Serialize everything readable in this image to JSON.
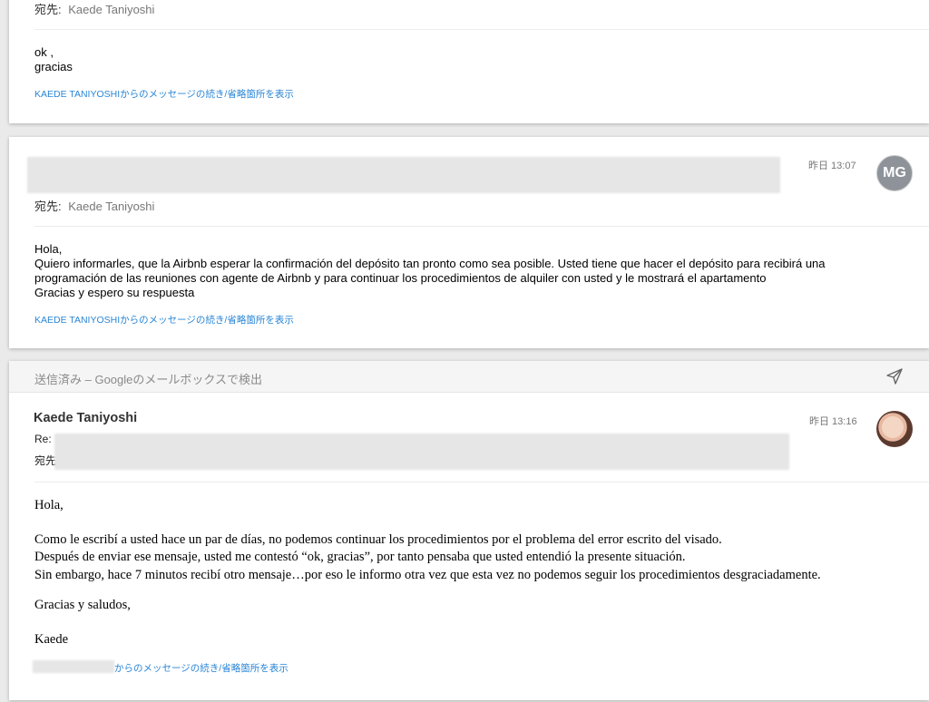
{
  "messages": [
    {
      "to_label": "宛先:",
      "to_name": "Kaede Taniyoshi",
      "body": "ok ,\ngracias",
      "link_prefix": "KAEDE TANIYOSHIからのメッセージの",
      "link_action": "続き/省略箇所を表示"
    },
    {
      "time": "昨日 13:07",
      "avatar_initials": "MG",
      "to_label": "宛先:",
      "to_name": "Kaede Taniyoshi",
      "body": "Hola,\nQuiero informarles, que la Airbnb esperar la confirmación del depósito tan pronto como sea posible. Usted tiene que hacer el depósito para recibirá una\nprogramación de las reuniones con agente de Airbnb y para continuar los procedimientos de alquiler con usted y le mostrará el apartamento\nGracias y espero su respuesta",
      "link_prefix": "KAEDE TANIYOSHIからのメッセージの",
      "link_action": "続き/省略箇所を表示"
    },
    {
      "search_text": "送信済み – Googleのメールボックスで検出",
      "sender": "Kaede Taniyoshi",
      "time": "昨日 13:16",
      "re_label": "Re:",
      "to_label": "宛先:",
      "greeting": "Hola,",
      "para1": "Como le escribí a usted hace un par de días, no podemos continuar los procedimientos por el problema del error escrito del visado.",
      "para2": "Después de enviar ese mensaje, usted me contestó “ok, gracias”, por tanto pensaba que usted entendió la presente situación.",
      "para3": "Sin embargo, hace 7 minutos recibí otro mensaje…por eso le informo otra vez que esta vez no podemos seguir los procedimientos desgraciadamente.",
      "closing": "Gracias y saludos,",
      "signature": "Kaede",
      "link_prefix": "からのメッセージの",
      "link_action": "続き/省略箇所を表示"
    }
  ]
}
